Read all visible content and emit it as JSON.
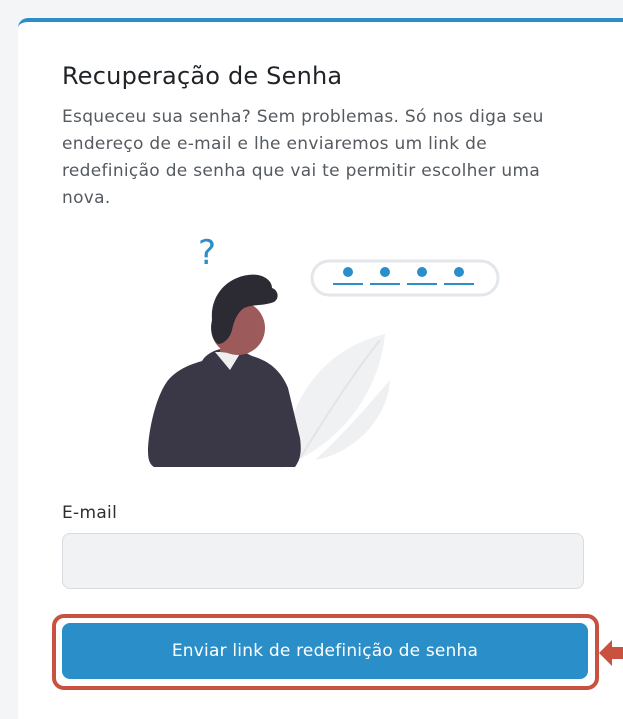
{
  "form": {
    "title": "Recuperação de Senha",
    "description": "Esqueceu sua senha? Sem problemas. Só nos diga seu endereço de e-mail e lhe enviaremos um link de redefinição de senha que vai te permitir escolher uma nova.",
    "illustration": {
      "question_mark": "?"
    },
    "email_label": "E-mail",
    "email_value": "",
    "email_placeholder": "",
    "submit_label": "Enviar link de redefinição de senha"
  },
  "colors": {
    "accent": "#2a8ec9",
    "highlight": "#c8523f",
    "text": "#1f2327",
    "muted_text": "#555a60"
  },
  "icons": {
    "illustration": "forgot-password-person-illustration",
    "arrow": "arrow-left-pointer-icon"
  }
}
